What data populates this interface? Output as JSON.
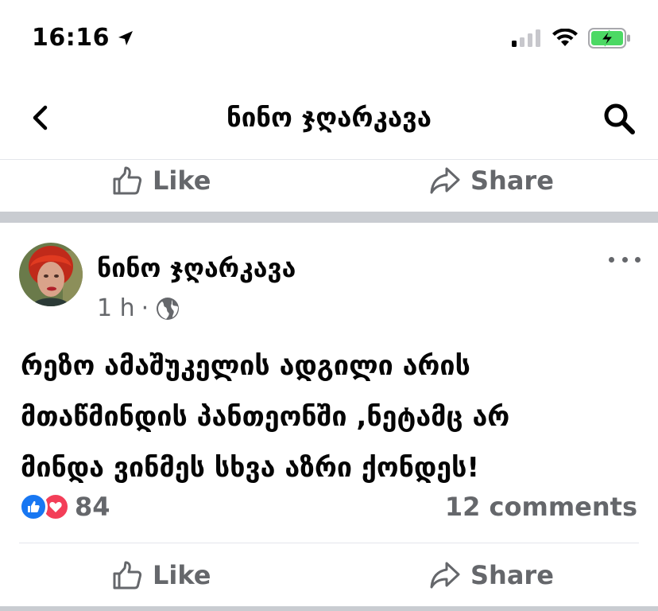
{
  "status_bar": {
    "time": "16:16",
    "location_icon": "location-arrow-icon",
    "signal_icon": "cellular-signal-icon",
    "wifi_icon": "wifi-icon",
    "battery_icon": "battery-charging-icon"
  },
  "nav": {
    "title": "ნინო ჯღარკავა",
    "back_icon": "chevron-left-icon",
    "search_icon": "search-icon"
  },
  "previous_post_actions": {
    "like_label": "Like",
    "share_label": "Share"
  },
  "post": {
    "author": "ნინო ჯღარკავა",
    "time": "1 h",
    "separator": "·",
    "audience_icon": "globe-icon",
    "text_lines": [
      "რეზო ამაშუკელის ადგილი არის",
      "მთაწმინდის პანთეონში ,ნეტამც არ",
      "მინდა ვინმეს სხვა აზრი ქონდეს!"
    ],
    "reactions": {
      "types": [
        "like",
        "love"
      ],
      "count": "84"
    },
    "comments": "12 comments",
    "actions": {
      "like_label": "Like",
      "share_label": "Share"
    }
  },
  "colors": {
    "secondary_text": "#65676b",
    "like_blue": "#1877f2",
    "love_red": "#f33e58",
    "battery_green": "#4cd964",
    "separator_gray": "#c9ccd1"
  }
}
